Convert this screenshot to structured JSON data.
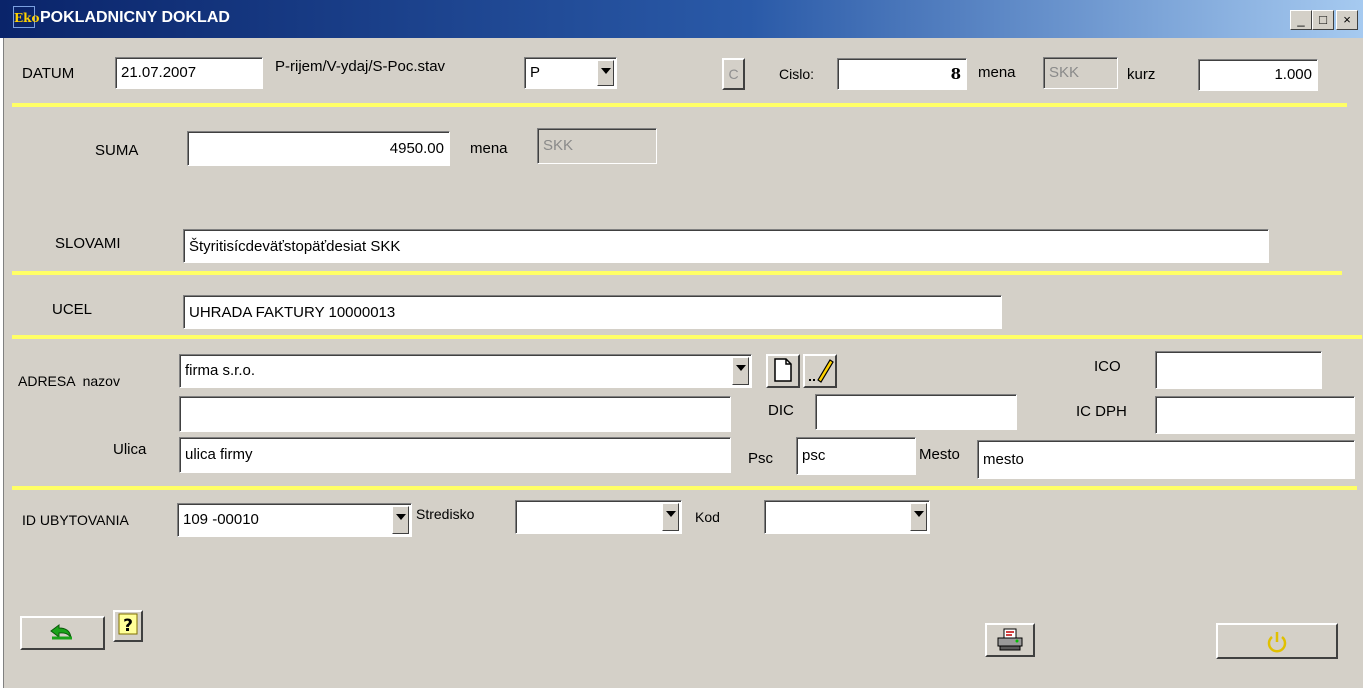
{
  "window": {
    "title": "POKLADNICNY DOKLAD",
    "icon_text": "Eko",
    "min": "_",
    "max": "□",
    "close": "×"
  },
  "header": {
    "datum_label": "DATUM",
    "datum_value": "21.07.2007",
    "type_label": "P-rijem/V-ydaj/S-Poc.stav",
    "type_value": "P",
    "c_button": "C",
    "cislo_label": "Cislo:",
    "cislo_value": "8",
    "mena_label": "mena",
    "mena_value": "SKK",
    "kurz_label": "kurz",
    "kurz_value": "1.000"
  },
  "suma": {
    "label": "SUMA",
    "value": "4950.00",
    "mena_label": "mena",
    "mena_value": "SKK"
  },
  "slovami": {
    "label": "SLOVAMI",
    "value": "Štyritisícdeväťstopäťdesiat SKK"
  },
  "ucel": {
    "label": "UCEL",
    "value": "UHRADA FAKTURY 10000013"
  },
  "adresa": {
    "nazov_label": "ADRESA  nazov",
    "nazov_value": "firma s.r.o.",
    "nazov2_value": "",
    "ico_label": "ICO",
    "ico_value": "",
    "dic_label": "DIC",
    "dic_value": "",
    "icdph_label": "IC DPH",
    "icdph_value": "",
    "ulica_label": "Ulica",
    "ulica_value": "ulica firmy",
    "psc_label": "Psc",
    "psc_value": "psc",
    "mesto_label": "Mesto",
    "mesto_value": "mesto"
  },
  "footer_fields": {
    "id_label": "ID UBYTOVANIA",
    "id_value": "109 -00010",
    "stredisko_label": "Stredisko",
    "stredisko_value": "",
    "kod_label": "Kod",
    "kod_value": ""
  },
  "colors": {
    "separator": "#ffff66",
    "undo_arrow": "#1aa31a",
    "power": "#e0c000"
  },
  "icons": [
    "undo-icon",
    "help-icon",
    "print-icon",
    "power-icon",
    "new-document-icon",
    "edit-icon"
  ]
}
